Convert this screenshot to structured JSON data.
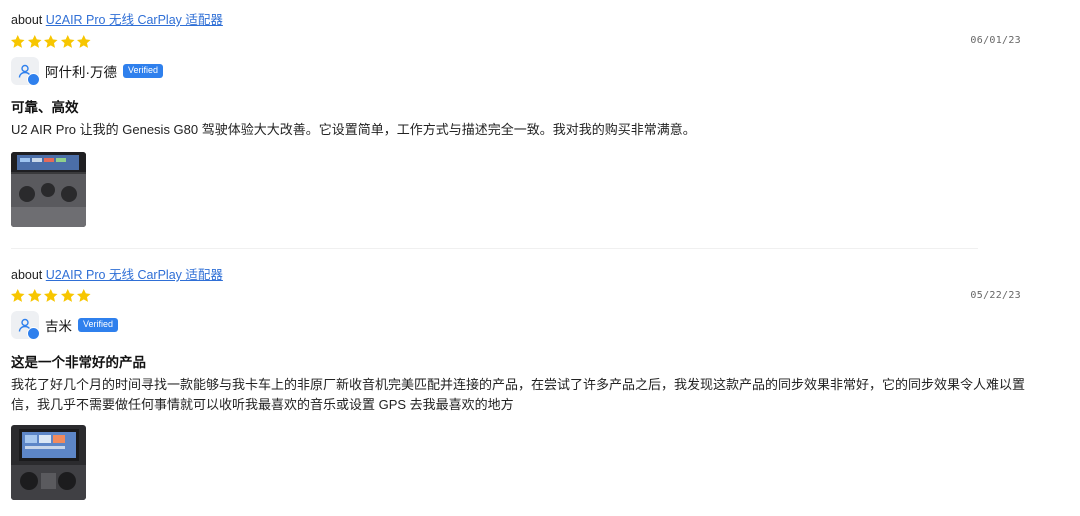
{
  "colors": {
    "link": "#2f6fd6",
    "star": "#f7c600",
    "badge": "#2f80ed"
  },
  "reviews": [
    {
      "about_prefix": "about",
      "product": "U2AIR Pro 无线 CarPlay 适配器",
      "rating": 5,
      "date": "06/01/23",
      "user": "阿什利·万德",
      "badge": "Verified",
      "title": "可靠、高效",
      "body": "U2 AIR Pro 让我的 Genesis G80 驾驶体验大大改善。它设置简单，工作方式与描述完全一致。我对我的购买非常满意。"
    },
    {
      "about_prefix": "about",
      "product": "U2AIR Pro 无线 CarPlay 适配器",
      "rating": 5,
      "date": "05/22/23",
      "user": "吉米",
      "badge": "Verified",
      "title": "这是一个非常好的产品",
      "body": "我花了好几个月的时间寻找一款能够与我卡车上的非原厂新收音机完美匹配并连接的产品，在尝试了许多产品之后，我发现这款产品的同步效果非常好，它的同步效果令人难以置信，我几乎不需要做任何事情就可以收听我最喜欢的音乐或设置 GPS 去我最喜欢的地方"
    }
  ]
}
